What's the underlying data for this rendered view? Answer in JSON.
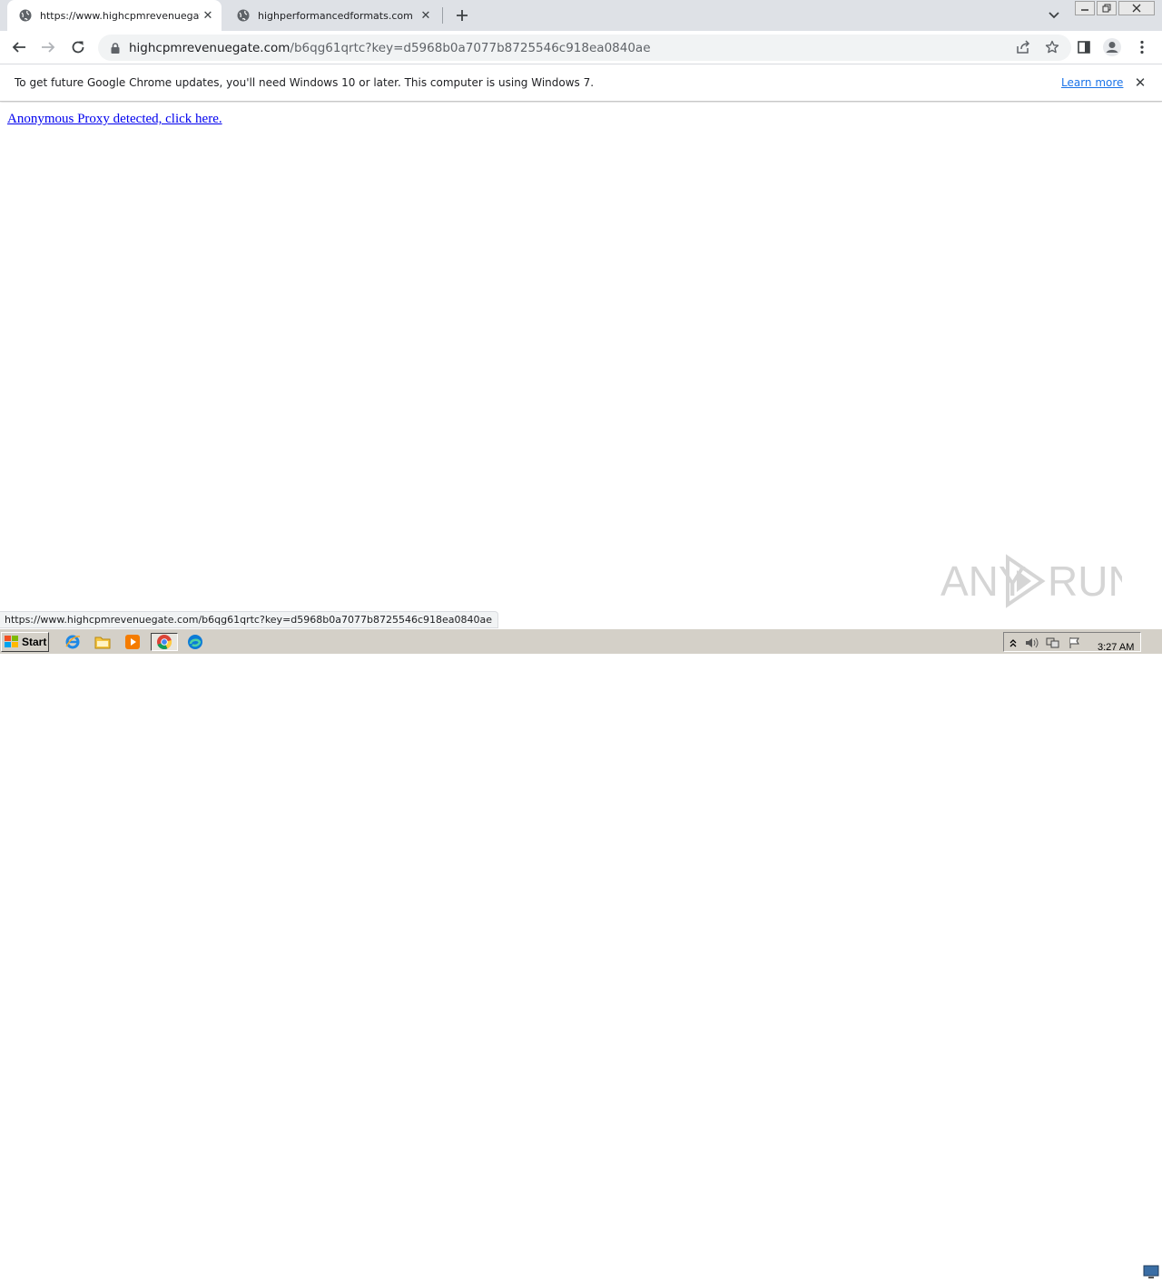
{
  "browser": {
    "tabs": [
      {
        "title": "https://www.highcpmrevenuegate.c",
        "active": true
      },
      {
        "title": "highperformancedformats.com",
        "active": false
      }
    ],
    "address": {
      "host": "highcpmrevenuegate.com",
      "path": "/b6qg61qrtc?key=d5968b0a7077b8725546c918ea0840ae"
    },
    "infobar": {
      "message": "To get future Google Chrome updates, you'll need Windows 10 or later. This computer is using Windows 7.",
      "link": "Learn more"
    },
    "status_url": "https://www.highcpmrevenuegate.com/b6qg61qrtc?key=d5968b0a7077b8725546c918ea0840ae"
  },
  "page": {
    "link_text": "Anonymous Proxy detected, click here."
  },
  "watermark": {
    "text_left": "ANY",
    "text_right": "RUN"
  },
  "taskbar": {
    "start_label": "Start",
    "clock": "3:27 AM"
  },
  "colors": {
    "link": "#0000ee",
    "chrome_tabstrip": "#dee1e6",
    "taskbar": "#d4d0c8",
    "learn_more": "#1a73e8"
  }
}
